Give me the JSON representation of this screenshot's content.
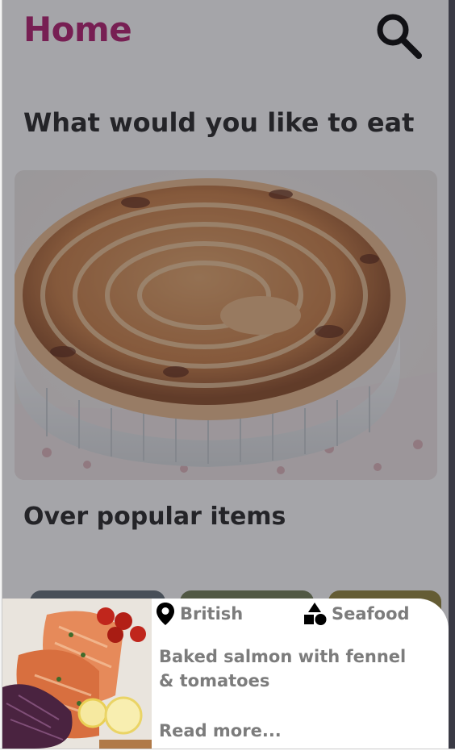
{
  "header": {
    "title": "Home",
    "search_icon": "search-icon"
  },
  "sections": {
    "question": "What would you like to eat",
    "popular": "Over popular items"
  },
  "colors": {
    "title": "#b0196b",
    "heading": "#222222",
    "meta_text": "#7c7c7c"
  },
  "bottom_sheet": {
    "region": "British",
    "region_icon": "location-pin-icon",
    "category": "Seafood",
    "category_icon": "shapes-icon",
    "dish": "Baked salmon with fennel & tomatoes",
    "read_more": "Read more..."
  }
}
